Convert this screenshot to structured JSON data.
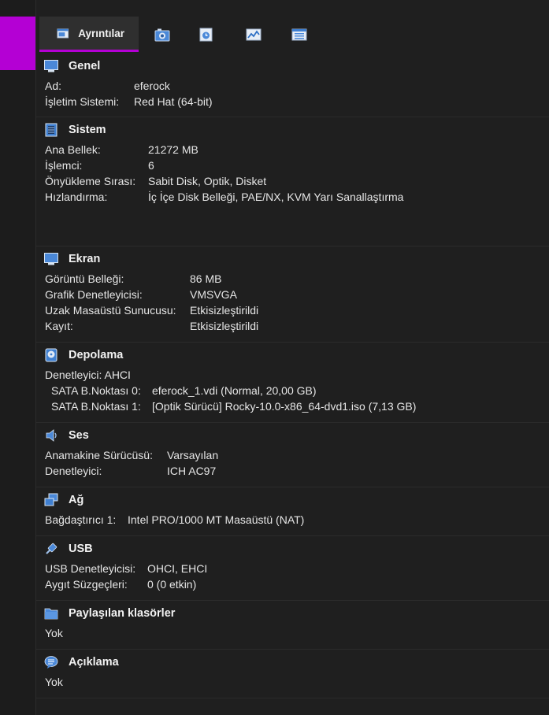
{
  "tabs": [
    {
      "label": "Ayrıntılar",
      "icon": "details-icon"
    },
    {
      "icon": "snapshots-icon"
    },
    {
      "icon": "logs-icon"
    },
    {
      "icon": "activity-icon"
    },
    {
      "icon": "properties-icon"
    }
  ],
  "sections": {
    "general": {
      "title": "Genel",
      "rows": [
        {
          "label": "Ad:",
          "value": "eferock"
        },
        {
          "label": "İşletim Sistemi:",
          "value": "Red Hat (64-bit)"
        }
      ]
    },
    "system": {
      "title": "Sistem",
      "rows": [
        {
          "label": "Ana Bellek:",
          "value": "21272 MB"
        },
        {
          "label": "İşlemci:",
          "value": "6"
        },
        {
          "label": "Önyükleme Sırası:",
          "value": "Sabit Disk, Optik, Disket"
        },
        {
          "label": "Hızlandırma:",
          "value": "İç İçe Disk Belleği, PAE/NX, KVM Yarı Sanallaştırma"
        }
      ]
    },
    "display": {
      "title": "Ekran",
      "rows": [
        {
          "label": "Görüntü Belleği:",
          "value": "86 MB"
        },
        {
          "label": "Grafik Denetleyicisi:",
          "value": "VMSVGA"
        },
        {
          "label": "Uzak Masaüstü Sunucusu:",
          "value": "Etkisizleştirildi"
        },
        {
          "label": "Kayıt:",
          "value": "Etkisizleştirildi"
        }
      ]
    },
    "storage": {
      "title": "Depolama",
      "controller": "Denetleyici: AHCI",
      "rows": [
        {
          "label": "SATA B.Noktası 0:",
          "value": "eferock_1.vdi (Normal, 20,00 GB)"
        },
        {
          "label": "SATA B.Noktası 1:",
          "value": "[Optik Sürücü] Rocky-10.0-x86_64-dvd1.iso (7,13 GB)"
        }
      ]
    },
    "audio": {
      "title": "Ses",
      "rows": [
        {
          "label": "Anamakine Sürücüsü:",
          "value": "Varsayılan"
        },
        {
          "label": "Denetleyici:",
          "value": "ICH AC97"
        }
      ]
    },
    "network": {
      "title": "Ağ",
      "rows": [
        {
          "label": "Bağdaştırıcı 1:",
          "value": "Intel PRO/1000 MT Masaüstü (NAT)"
        }
      ]
    },
    "usb": {
      "title": "USB",
      "rows": [
        {
          "label": "USB Denetleyicisi:",
          "value": "OHCI, EHCI"
        },
        {
          "label": "Aygıt Süzgeçleri:",
          "value": "0 (0 etkin)"
        }
      ]
    },
    "shared": {
      "title": "Paylaşılan klasörler",
      "value": "Yok"
    },
    "description": {
      "title": "Açıklama",
      "value": "Yok"
    }
  }
}
